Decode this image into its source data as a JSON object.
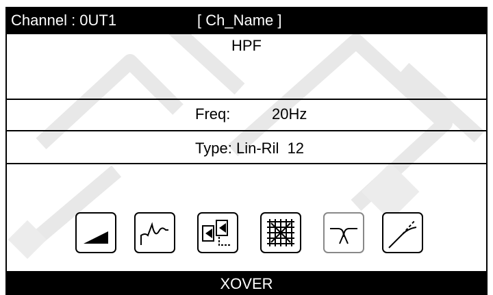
{
  "header": {
    "channel_label": "Channel : 0UT1",
    "channel_name": "[ Ch_Name ]"
  },
  "filter": {
    "mode": "HPF",
    "freq_label": "Freq:",
    "freq_value": "20Hz",
    "type_label": "Type:",
    "type_value": "Lin-Ril  12"
  },
  "toolbar": {
    "icons": [
      "gain-ramp-icon",
      "eq-curve-icon",
      "routing-icon",
      "matrix-icon",
      "crossover-icon",
      "limiter-icon"
    ],
    "selected": "crossover-icon"
  },
  "footer": {
    "label": "XOVER"
  },
  "colors": {
    "background": "#ffffff",
    "bar": "#000000",
    "watermark": "#e6e6e6"
  }
}
